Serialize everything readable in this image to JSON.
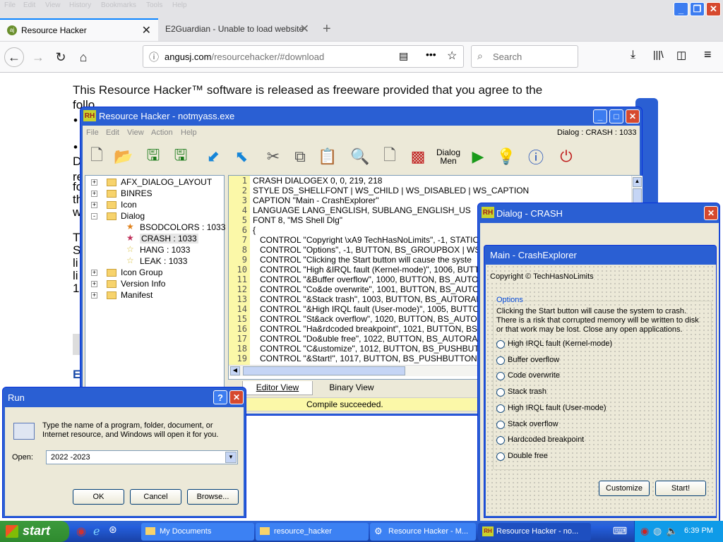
{
  "browser": {
    "menubar": [
      "File",
      "Edit",
      "View",
      "History",
      "Bookmarks",
      "Tools",
      "Help"
    ],
    "tabs": [
      {
        "title": "Resource Hacker",
        "favicon": "aj"
      },
      {
        "title": "E2Guardian - Unable to load website"
      }
    ],
    "url": "angusj.com/resourcehacker/#download",
    "url_host": "angusj.com",
    "url_path": "/resourcehacker/#download",
    "search_placeholder": "Search"
  },
  "page": {
    "paragraph_start": "This Resource Hacker™ software is released as freeware provided that you agree to the",
    "line2": "follo",
    "fragments": [
      "D",
      "re",
      "fo",
      "th",
      "w",
      "T",
      "S",
      "li",
      "li",
      "1",
      "E"
    ]
  },
  "rh": {
    "title": "Resource Hacker - notmyass.exe",
    "menu": [
      "File",
      "Edit",
      "View",
      "Action",
      "Help"
    ],
    "dialog_label": "Dialog : CRASH : 1033",
    "toolbar_dialog_label": "Dialog",
    "toolbar_menu_label": "Men",
    "tree": [
      {
        "label": "AFX_DIALOG_LAYOUT",
        "level": 0,
        "exp": "+"
      },
      {
        "label": "BINRES",
        "level": 0,
        "exp": "+"
      },
      {
        "label": "Icon",
        "level": 0,
        "exp": "+"
      },
      {
        "label": "Dialog",
        "level": 0,
        "exp": "-"
      },
      {
        "label": "BSODCOLORS : 1033",
        "level": 1
      },
      {
        "label": "CRASH : 1033",
        "level": 1
      },
      {
        "label": "HANG : 1033",
        "level": 1
      },
      {
        "label": "LEAK : 1033",
        "level": 1
      },
      {
        "label": "Icon Group",
        "level": 0,
        "exp": "+"
      },
      {
        "label": "Version Info",
        "level": 0,
        "exp": "+"
      },
      {
        "label": "Manifest",
        "level": 0,
        "exp": "+"
      }
    ],
    "code": [
      "CRASH DIALOGEX 0, 0, 219, 218",
      "STYLE DS_SHELLFONT | WS_CHILD | WS_DISABLED | WS_CAPTION",
      "CAPTION \"Main - CrashExplorer\"",
      "LANGUAGE LANG_ENGLISH, SUBLANG_ENGLISH_US",
      "FONT 8, \"MS Shell Dlg\"",
      "{",
      "   CONTROL \"Copyright \\xA9 TechHasNoLimits\", -1, STATIC",
      "   CONTROL \"Options\", -1, BUTTON, BS_GROUPBOX | WS_",
      "   CONTROL \"Clicking the Start button will cause the syste",
      "   CONTROL \"High &IRQL fault (Kernel-mode)\", 1006, BUTT",
      "   CONTROL \"&Buffer overflow\", 1000, BUTTON, BS_AUTO",
      "   CONTROL \"Co&de overwrite\", 1001, BUTTON, BS_AUTO",
      "   CONTROL \"&Stack trash\", 1003, BUTTON, BS_AUTORAD",
      "   CONTROL \"&High IRQL fault (User-mode)\", 1005, BUTTO",
      "   CONTROL \"St&ack overflow\", 1020, BUTTON, BS_AUTO",
      "   CONTROL \"Ha&rdcoded breakpoint\", 1021, BUTTON, BS_",
      "   CONTROL \"Do&uble free\", 1022, BUTTON, BS_AUTORA",
      "   CONTROL \"C&ustomize\", 1012, BUTTON, BS_PUSHBUTT",
      "   CONTROL \"&Start!\", 1017, BUTTON, BS_PUSHBUTTON"
    ],
    "tabs": [
      "Editor View",
      "Binary View"
    ],
    "status": "Compile succeeded."
  },
  "dialog": {
    "title": "Dialog - CRASH",
    "inner_title": "Main - CrashExplorer",
    "copyright": "Copyright © TechHasNoLimits",
    "group": "Options",
    "description_lines": [
      "Clicking the Start button will cause the system to crash.",
      "There is a risk that corrupted memory will be written to disk",
      "or that work may be lost. Close any open applications."
    ],
    "options": [
      "High IRQL fault (Kernel-mode)",
      "Buffer overflow",
      "Code overwrite",
      "Stack trash",
      "High IRQL fault (User-mode)",
      "Stack overflow",
      "Hardcoded breakpoint",
      "Double free"
    ],
    "customize": "Customize",
    "start": "Start!"
  },
  "run": {
    "title": "Run",
    "help": "?",
    "description_line1": "Type the name of a program, folder, document, or",
    "description_line2": "Internet resource, and Windows will open it for you.",
    "open_label": "Open:",
    "open_value": "2022 -2023",
    "ok": "OK",
    "cancel": "Cancel",
    "browse": "Browse..."
  },
  "taskbar": {
    "start": "start",
    "tasks": [
      "My Documents",
      "resource_hacker",
      "Resource Hacker - M...",
      "Resource Hacker - no..."
    ],
    "clock": "6:39 PM"
  }
}
